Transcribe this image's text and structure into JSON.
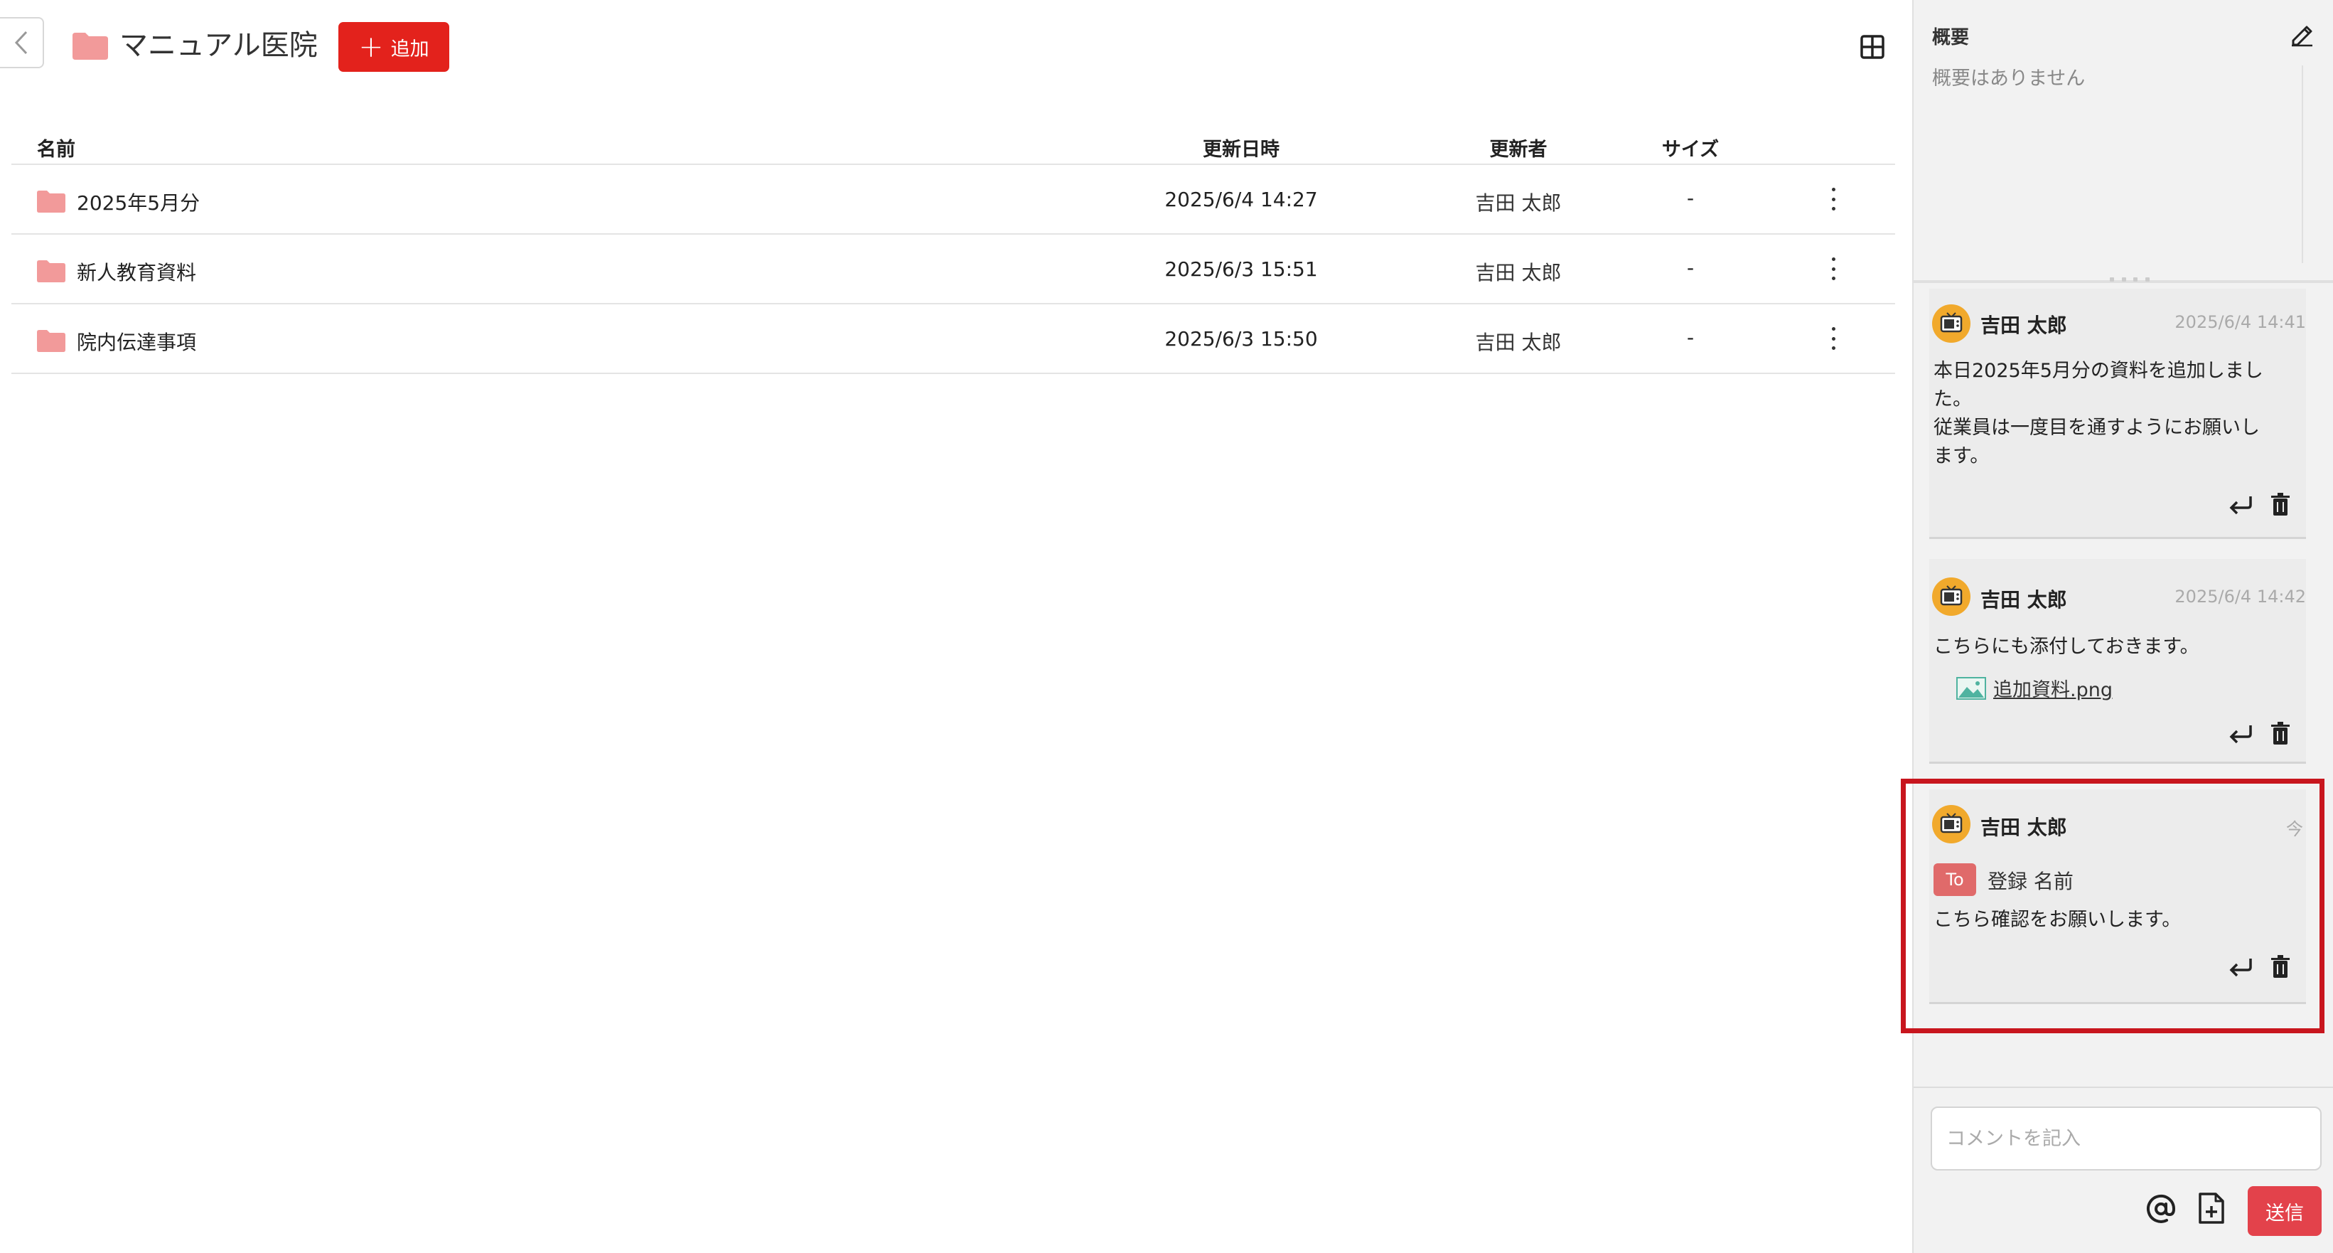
{
  "header": {
    "folder_title": "マニュアル医院",
    "add_button_label": "追加"
  },
  "table": {
    "columns": {
      "name": "名前",
      "updated_at": "更新日時",
      "updated_by": "更新者",
      "size": "サイズ"
    },
    "rows": [
      {
        "name": "2025年5月分",
        "updated_at": "2025/6/4 14:27",
        "updated_by": "吉田 太郎",
        "size": "-"
      },
      {
        "name": "新人教育資料",
        "updated_at": "2025/6/3 15:51",
        "updated_by": "吉田 太郎",
        "size": "-"
      },
      {
        "name": "院内伝達事項",
        "updated_at": "2025/6/3 15:50",
        "updated_by": "吉田 太郎",
        "size": "-"
      }
    ]
  },
  "panel": {
    "summary_title": "概要",
    "summary_text": "概要はありません",
    "comments": [
      {
        "author": "吉田 太郎",
        "time": "2025/6/4 14:41",
        "text": "本日2025年5月分の資料を追加しまし\nた。\n従業員は一度目を通すようにお願いし\nます。"
      },
      {
        "author": "吉田 太郎",
        "time": "2025/6/4 14:42",
        "text": "こちらにも添付しておきます。",
        "attachment": "追加資料.png"
      },
      {
        "author": "吉田 太郎",
        "time": "今",
        "to_label": "To",
        "to_name": "登録 名前",
        "text": "こちら確認をお願いします。"
      }
    ],
    "comment_input_placeholder": "コメントを記入",
    "send_button_label": "送信"
  },
  "colors": {
    "accent_red": "#e3221c",
    "folder_pink": "#f29a9a",
    "avatar_orange": "#f1a92c",
    "highlight_border": "#c8161e"
  },
  "icons": [
    "back-chevron-icon",
    "folder-icon",
    "plus-icon",
    "grid-view-icon",
    "more-vertical-icon",
    "edit-icon",
    "avatar-tv-icon",
    "reply-icon",
    "trash-icon",
    "image-file-icon",
    "at-mention-icon",
    "attach-file-icon"
  ]
}
